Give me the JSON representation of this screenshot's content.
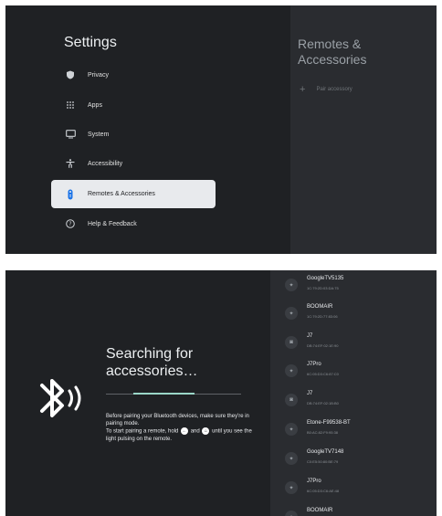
{
  "settings": {
    "title": "Settings",
    "items": [
      {
        "label": "Privacy",
        "icon": "shield-icon"
      },
      {
        "label": "Apps",
        "icon": "apps-grid-icon"
      },
      {
        "label": "System",
        "icon": "monitor-icon"
      },
      {
        "label": "Accessibility",
        "icon": "accessibility-icon"
      },
      {
        "label": "Remotes & Accessories",
        "icon": "remote-icon",
        "selected": true
      },
      {
        "label": "Help & Feedback",
        "icon": "help-icon"
      }
    ],
    "right": {
      "title_line1": "Remotes &",
      "title_line2": "Accessories",
      "pair_label": "Pair accessory"
    }
  },
  "search": {
    "title_line1": "Searching for",
    "title_line2": "accessories…",
    "description": "Before pairing your Bluetooth devices, make sure they're in pairing mode.",
    "hint_part1": "To start pairing a remote, hold",
    "hint_part2": "and",
    "hint_part3": "until you see the light pulsing on the remote.",
    "progress": 0.45
  },
  "devices": [
    {
      "name": "GoogleTV5135",
      "addr": "1C:79:2D:03:DA:75",
      "icon": "bluetooth-device-icon"
    },
    {
      "name": "BOOMAIR",
      "addr": "1C:79:2D:77:83:06",
      "icon": "bluetooth-device-icon"
    },
    {
      "name": "J7",
      "addr": "DB:74:EF:02:1E:90",
      "icon": "headphones-icon"
    },
    {
      "name": "J7Pro",
      "addr": "6C:05:D3:C6:87:C0",
      "icon": "bluetooth-device-icon"
    },
    {
      "name": "J7",
      "addr": "DB:74:EF:02:1B:B0",
      "icon": "headphones-icon"
    },
    {
      "name": "Etone-F99538-BT",
      "addr": "B0:AC:82:F9:95:38",
      "icon": "bluetooth-device-icon"
    },
    {
      "name": "GoogleTV7148",
      "addr": "C0:E5:50:80:BE:79",
      "icon": "bluetooth-device-icon"
    },
    {
      "name": "J7Pro",
      "addr": "6C:05:D3:C6:AE:48",
      "icon": "bluetooth-device-icon"
    },
    {
      "name": "BOOMAIR",
      "addr": "",
      "icon": "bluetooth-device-icon"
    }
  ]
}
